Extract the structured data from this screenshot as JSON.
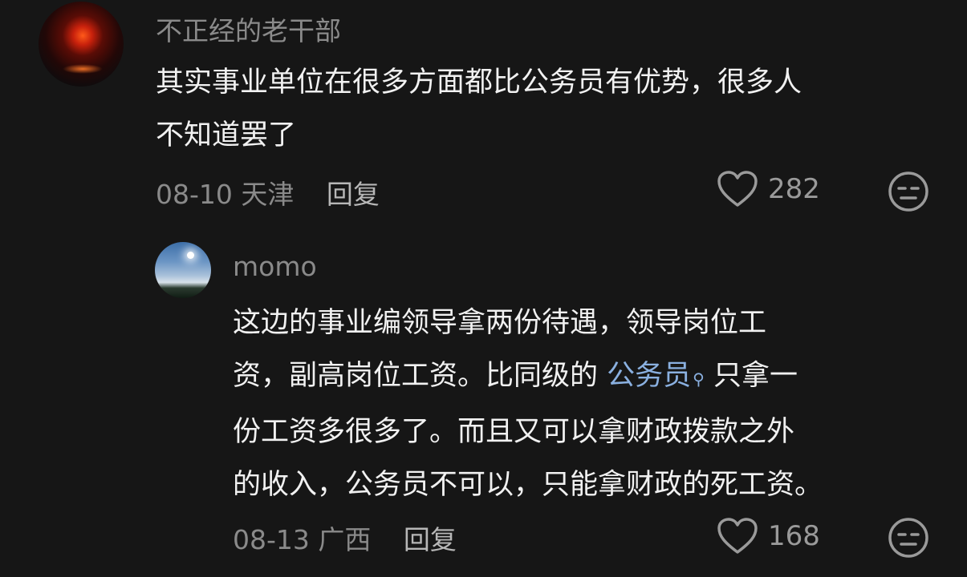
{
  "comment1": {
    "username": "不正经的老干部",
    "text_line1": "其实事业单位在很多方面都比公务员有优势，很多人",
    "text_line2": "不知道罢了",
    "date": "08-10",
    "location": "天津",
    "reply_label": "回复",
    "likes": "282",
    "icons": {
      "like": "heart-outline-icon",
      "dislike": "unamused-face-icon"
    }
  },
  "comment2": {
    "username": "momo",
    "text_line1": "这边的事业编领导拿两份待遇，领导岗位工",
    "text_line2a": "资，副高岗位工资。比同级的 ",
    "link": "公务员",
    "text_line2b": " 只拿一",
    "text_line3": "份工资多很多了。而且又可以拿财政拨款之外",
    "text_line4": "的收入，公务员不可以，只能拿财政的死工资。",
    "date": "08-13",
    "location": "广西",
    "reply_label": "回复",
    "likes": "168",
    "link_color": "#8ab0e0",
    "icons": {
      "like": "heart-outline-icon",
      "dislike": "unamused-face-icon"
    }
  },
  "colors": {
    "background": "#161616",
    "text": "#f1f1f1",
    "secondary": "#8a8a8a"
  }
}
